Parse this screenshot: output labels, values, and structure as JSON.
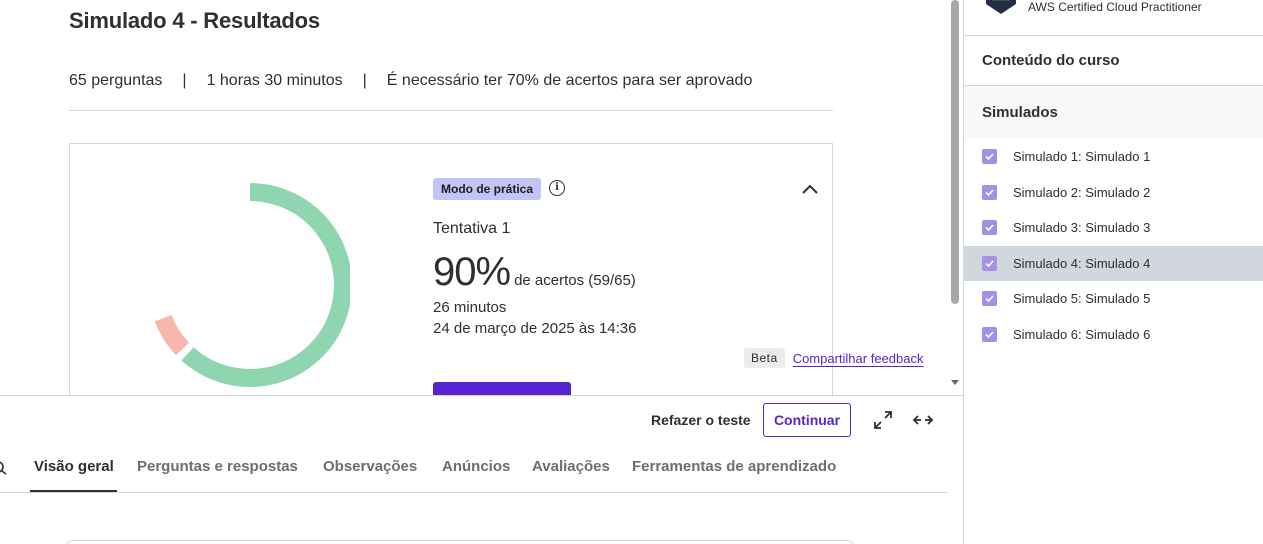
{
  "exam": {
    "title": "Simulado 4 - Resultados",
    "questions": "65 perguntas",
    "duration": "1 horas 30 minutos",
    "pass_rule": "É necessário ter 70% de acertos para ser aprovado",
    "separator": "|"
  },
  "result": {
    "mode_badge": "Modo de prática",
    "info_glyph": "i",
    "attempt": "Tentativa 1",
    "score": "90%",
    "score_desc": "de acertos (59/65)",
    "time_taken": "26 minutos",
    "date": "24 de março de 2025 às 14:36",
    "correct_fraction": 0.9077,
    "colors": {
      "correct": "#8fd5b0",
      "incorrect": "#f7b7ae",
      "accent": "#5624d0"
    }
  },
  "feedback": {
    "beta": "Beta",
    "link": "Compartilhar feedback"
  },
  "controls": {
    "retake": "Refazer o teste",
    "continue": "Continuar",
    "fullscreen_icon": "expand-icon",
    "expand_width_icon": "arrows-horizontal-icon"
  },
  "tabs": [
    {
      "label": "Visão geral",
      "active": true
    },
    {
      "label": "Perguntas e respostas"
    },
    {
      "label": "Observações"
    },
    {
      "label": "Anúncios"
    },
    {
      "label": "Avaliações"
    },
    {
      "label": "Ferramentas de aprendizado"
    }
  ],
  "sidebar": {
    "course_name": "AWS Certified Cloud Practitioner",
    "content_title": "Conteúdo do curso",
    "section_title": "Simulados",
    "lessons": [
      {
        "label": "Simulado 1: Simulado 1",
        "checked": true
      },
      {
        "label": "Simulado 2: Simulado 2",
        "checked": true
      },
      {
        "label": "Simulado 3: Simulado 3",
        "checked": true
      },
      {
        "label": "Simulado 4: Simulado 4",
        "checked": true,
        "current": true
      },
      {
        "label": "Simulado 5: Simulado 5",
        "checked": true
      },
      {
        "label": "Simulado 6: Simulado 6",
        "checked": true
      }
    ]
  }
}
